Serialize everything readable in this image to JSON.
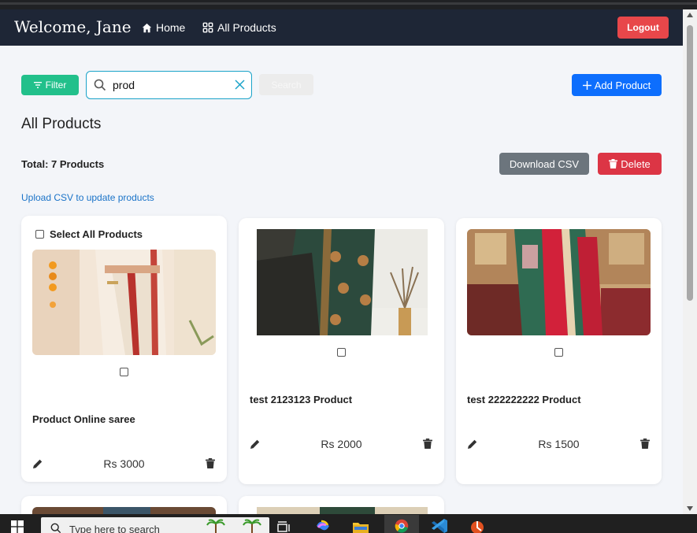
{
  "navbar": {
    "brand": "Welcome, Jane",
    "home": "Home",
    "all_products": "All Products",
    "logout": "Logout"
  },
  "toolbar": {
    "filter": "Filter",
    "search_value": "prod",
    "search_button": "Search",
    "add_product": "Add Product"
  },
  "page": {
    "title": "All Products",
    "total": "Total: 7 Products",
    "download_csv": "Download CSV",
    "delete": "Delete",
    "upload_link": "Upload CSV to update products"
  },
  "select_all": "Select All Products",
  "products": [
    {
      "name": "Product Online saree",
      "price": "Rs 3000"
    },
    {
      "name": "test 2123123 Product",
      "price": "Rs 2000"
    },
    {
      "name": "test 222222222 Product",
      "price": "Rs 1500"
    }
  ],
  "taskbar": {
    "search_placeholder": "Type here to search"
  },
  "colors": {
    "navbar": "#1e2636",
    "filter": "#22c08b",
    "primary": "#0d6efd",
    "danger": "#dc3545",
    "logout": "#e8474a",
    "secondary": "#6c757d"
  }
}
